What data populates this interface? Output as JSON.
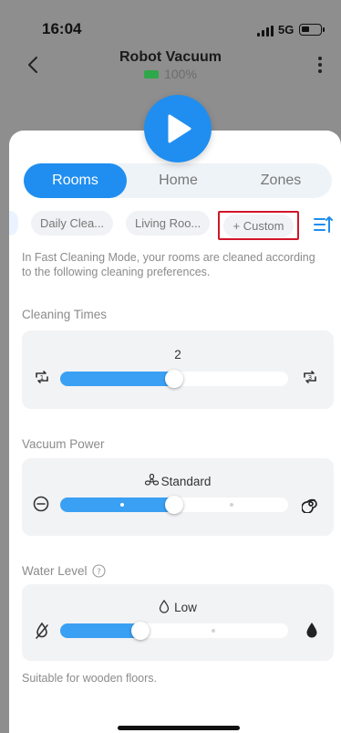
{
  "status": {
    "time": "16:04",
    "network": "5G"
  },
  "header": {
    "title": "Robot Vacuum",
    "battery": "100%"
  },
  "tabs": [
    {
      "label": "Rooms",
      "active": true
    },
    {
      "label": "Home",
      "active": false
    },
    {
      "label": "Zones",
      "active": false
    }
  ],
  "chips": [
    "Daily Clea...",
    "Living Roo...",
    "+ Custom"
  ],
  "info_text": "In Fast Cleaning Mode, your rooms are cleaned according to the following cleaning preferences.",
  "cleaning_times": {
    "label": "Cleaning Times",
    "value": "2",
    "level": 0.5,
    "min_icon": "repeat-1-icon",
    "max_icon": "repeat-3-icon"
  },
  "vacuum_power": {
    "label": "Vacuum Power",
    "value": "Standard",
    "level": 0.5,
    "min_icon": "power-off-icon",
    "max_icon": "max-suction-icon"
  },
  "water_level": {
    "label": "Water Level",
    "value": "Low",
    "level": 0.35,
    "min_icon": "no-water-icon",
    "max_icon": "water-drop-icon"
  },
  "footer_text": "Suitable for wooden floors.",
  "colors": {
    "accent": "#1f8ef0",
    "highlight": "#d0162a",
    "battery": "#2ea84a"
  }
}
